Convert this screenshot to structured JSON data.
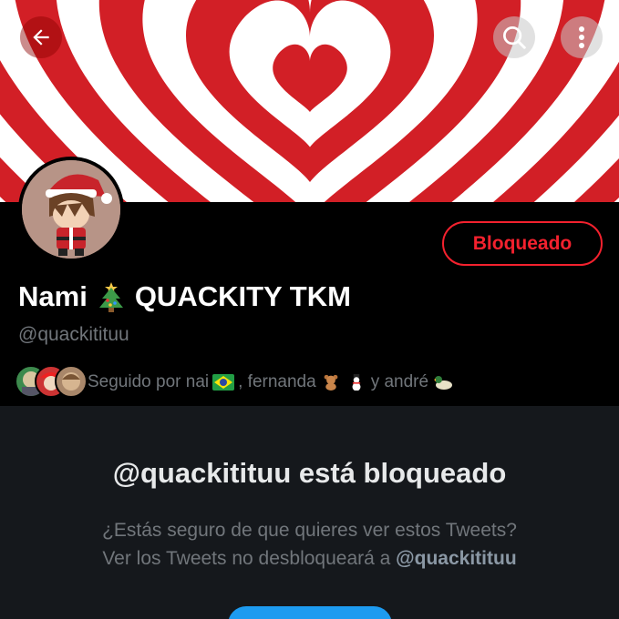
{
  "banner": {
    "colors": {
      "red": "#d21f26",
      "white": "#ffffff"
    }
  },
  "header": {
    "back_icon": "arrow-left-icon",
    "search_icon": "search-icon",
    "more_icon": "more-vertical-icon"
  },
  "profile": {
    "display_name": "Nami",
    "display_name_emoji": "christmas-tree-emoji",
    "display_name_suffix": "QUACKITY TKM",
    "handle": "@quackitituu",
    "blocked_button_label": "Bloqueado",
    "followed_by": {
      "prefix": "Seguido por nai",
      "middle": ", fernanda",
      "suffix": "y andré"
    }
  },
  "blocked_notice": {
    "title": "@quackitituu está bloqueado",
    "line1": "¿Estás seguro de que quieres ver estos Tweets?",
    "line2_prefix": "Ver los Tweets no desbloqueará a",
    "line2_handle": "@quackitituu"
  },
  "colors": {
    "accent_red": "#f4212e",
    "accent_blue": "#1d9bf0",
    "muted_text": "#71767b",
    "panel_bg": "#15181c"
  }
}
